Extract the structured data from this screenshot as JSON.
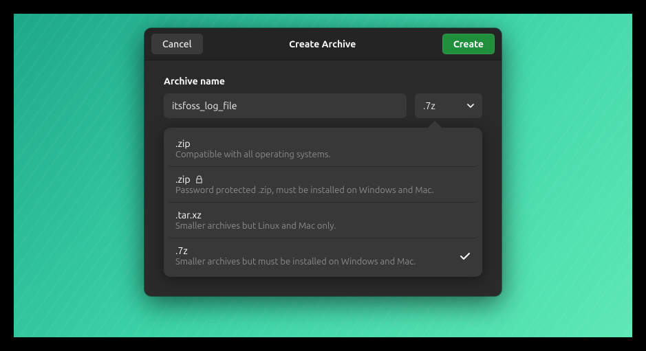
{
  "titlebar": {
    "cancel_label": "Cancel",
    "title": "Create Archive",
    "create_label": "Create"
  },
  "form": {
    "archive_name_label": "Archive name",
    "archive_name_value": "itsfoss_log_file",
    "selected_format": ".7z"
  },
  "format_options": [
    {
      "ext": ".zip",
      "desc": "Compatible with all operating systems.",
      "has_lock": false,
      "selected": false
    },
    {
      "ext": ".zip",
      "desc": "Password protected .zip, must be installed on Windows and Mac.",
      "has_lock": true,
      "selected": false
    },
    {
      "ext": ".tar.xz",
      "desc": "Smaller archives but Linux and Mac only.",
      "has_lock": false,
      "selected": false
    },
    {
      "ext": ".7z",
      "desc": "Smaller archives but must be installed on Windows and Mac.",
      "has_lock": false,
      "selected": true
    }
  ]
}
